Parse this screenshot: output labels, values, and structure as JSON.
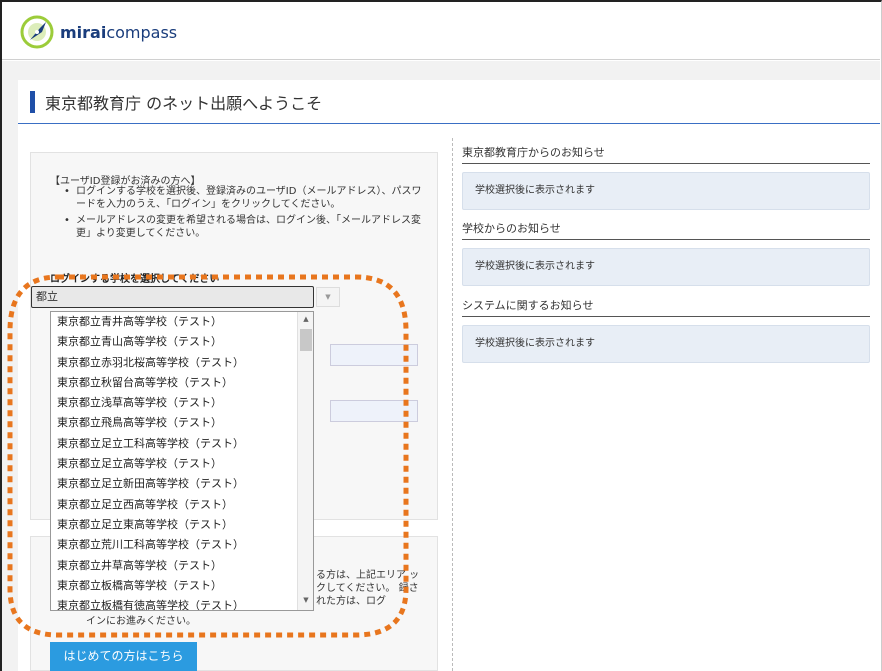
{
  "header": {
    "logo_bold": "mirai",
    "logo_regular": "compass"
  },
  "page_title": "東京都教育庁 のネット出願へようこそ",
  "login": {
    "heading": "【ユーザID登録がお済みの方へ】",
    "bullets": [
      "ログインする学校を選択後、登録済みのユーザID（メールアドレス）、パスワードを入力のうえ、「ログイン」をクリックしてください。",
      "メールアドレスの変更を希望される場合は、ログイン後、「メールアドレス変更」より変更してください。"
    ],
    "select_label": "ログインする学校を選択してください",
    "selected_value": "都立",
    "dropdown_options": [
      "東京都立青井高等学校（テスト）",
      "東京都立青山高等学校（テスト）",
      "東京都立赤羽北桜高等学校（テスト）",
      "東京都立秋留台高等学校（テスト）",
      "東京都立浅草高等学校（テスト）",
      "東京都立飛鳥高等学校（テスト）",
      "東京都立足立工科高等学校（テスト）",
      "東京都立足立高等学校（テスト）",
      "東京都立足立新田高等学校（テスト）",
      "東京都立足立西高等学校（テスト）",
      "東京都立足立東高等学校（テスト）",
      "東京都立荒川工科高等学校（テスト）",
      "東京都立井草高等学校（テスト）",
      "東京都立板橋高等学校（テスト）",
      "東京都立板橋有徳高等学校（テスト）"
    ]
  },
  "new_user": {
    "text_partial": "る方は、上記エリア ックしてください。 録された方は、ログ",
    "text_line2": "インにお進みください。",
    "button_label": "はじめての方はこちら"
  },
  "notices": [
    {
      "title": "東京都教育庁からのお知らせ",
      "body": "学校選択後に表示されます"
    },
    {
      "title": "学校からのお知らせ",
      "body": "学校選択後に表示されます"
    },
    {
      "title": "システムに関するお知らせ",
      "body": "学校選択後に表示されます"
    }
  ],
  "colors": {
    "accent_blue": "#1f4fa8",
    "button_blue": "#2b9be0",
    "highlight_orange": "#e8761e"
  }
}
